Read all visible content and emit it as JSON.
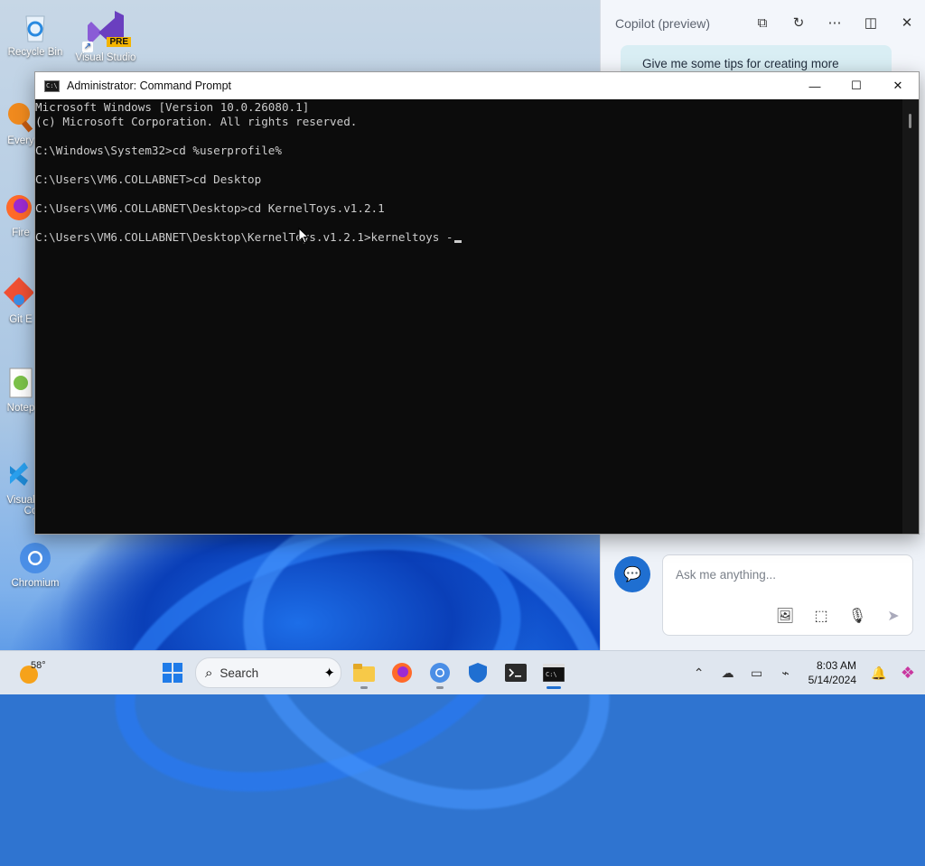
{
  "desktop": {
    "icons": [
      {
        "label": "Recycle Bin"
      },
      {
        "label": "Visual Studio",
        "badge": "PRE"
      },
      {
        "label": "Every"
      },
      {
        "label": "Fire"
      },
      {
        "label": "Git E"
      },
      {
        "label": "Notep"
      },
      {
        "label": "Visual",
        "label2": "Co"
      },
      {
        "label": "Chromium"
      }
    ]
  },
  "copilot": {
    "title": "Copilot (preview)",
    "suggestion": "Give me some tips for creating more",
    "ask_placeholder": "Ask me anything..."
  },
  "cmd": {
    "title": "Administrator: Command Prompt",
    "lines": [
      "Microsoft Windows [Version 10.0.26080.1]",
      "(c) Microsoft Corporation. All rights reserved.",
      "",
      "C:\\Windows\\System32>cd %userprofile%",
      "",
      "C:\\Users\\VM6.COLLABNET>cd Desktop",
      "",
      "C:\\Users\\VM6.COLLABNET\\Desktop>cd KernelToys.v1.2.1",
      "",
      "C:\\Users\\VM6.COLLABNET\\Desktop\\KernelToys.v1.2.1>kerneltoys -"
    ]
  },
  "taskbar": {
    "weather_temp": "58°",
    "search_label": "Search",
    "time": "8:03 AM",
    "date": "5/14/2024"
  },
  "colors": {
    "accent": "#1f6fd1",
    "console_bg": "#0c0c0c",
    "console_fg": "#cccccc"
  }
}
